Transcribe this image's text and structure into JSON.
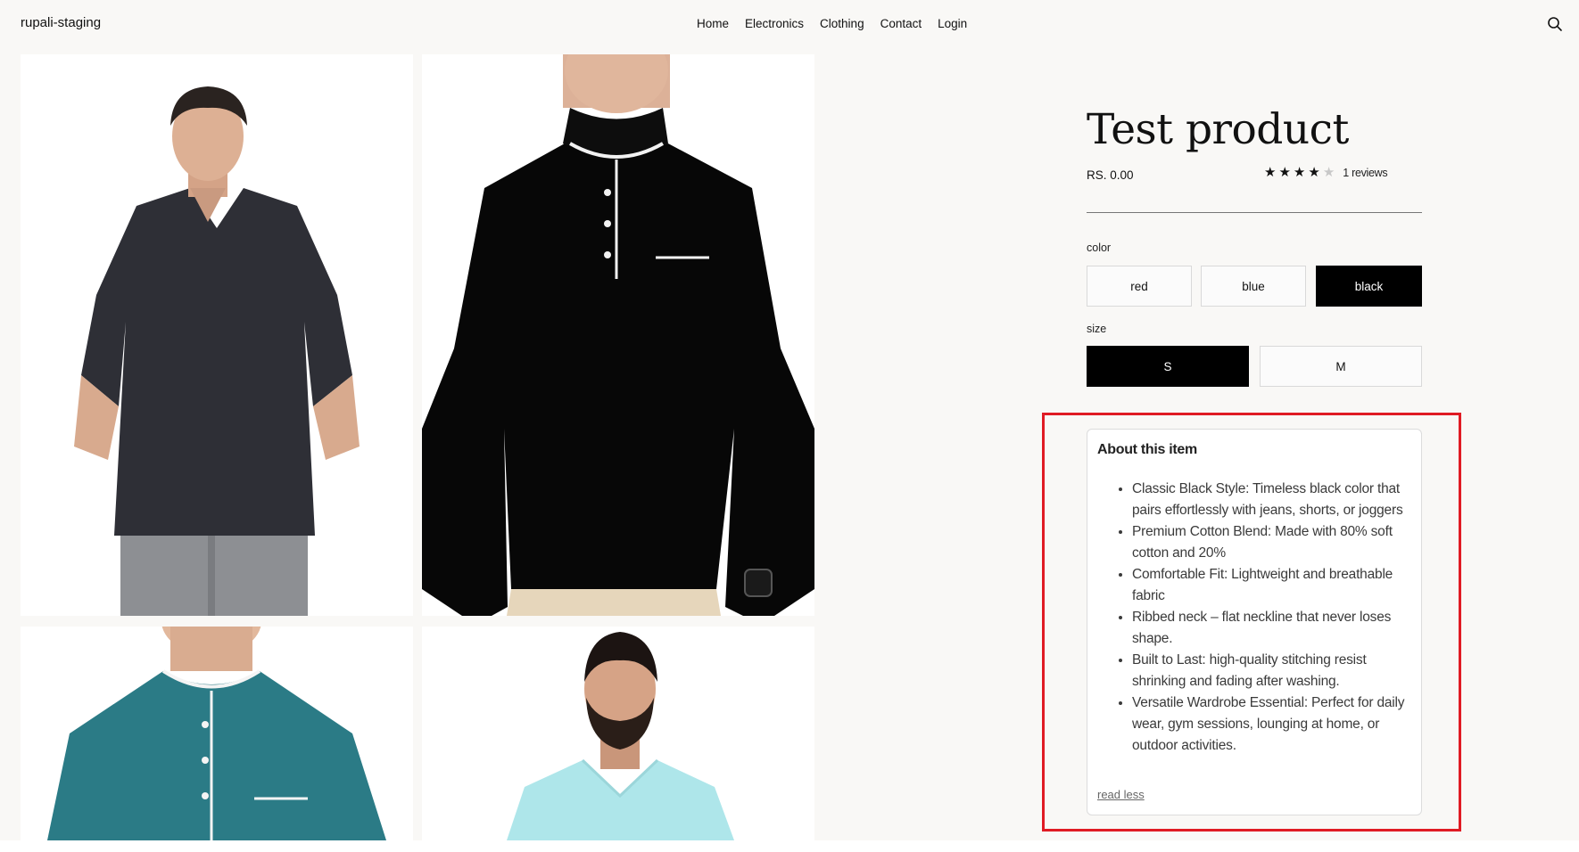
{
  "header": {
    "brand": "rupali-staging",
    "nav": [
      "Home",
      "Electronics",
      "Clothing",
      "Contact",
      "Login"
    ],
    "search_icon": "search-icon"
  },
  "product": {
    "title": "Test product",
    "price": "RS. 0.00",
    "rating": {
      "value": 4,
      "max": 5,
      "reviews_text": "1 reviews"
    },
    "color_label": "color",
    "colors": [
      "red",
      "blue",
      "black"
    ],
    "selected_color": "black",
    "size_label": "size",
    "sizes": [
      "S",
      "M"
    ],
    "selected_size": "S"
  },
  "about": {
    "heading": "About this item",
    "items": [
      "Classic Black Style: Timeless black color that pairs effortlessly with jeans, shorts, or joggers",
      "Premium Cotton Blend: Made with 80% soft cotton and 20%",
      "Comfortable Fit: Lightweight and breathable fabric",
      "Ribbed neck – flat neckline that never loses shape.",
      "Built to Last: high-quality stitching resist shrinking and fading after washing.",
      "Versatile Wardrobe Essential: Perfect for daily wear, gym sessions, lounging at home, or outdoor activities."
    ],
    "read_less": "read less"
  },
  "colors": {
    "accent_selected": "#000000",
    "highlight": "#e01b24",
    "shirt_dark_grey": "#2e2f36",
    "shirt_black": "#070707",
    "shirt_teal": "#2b7b86",
    "shirt_light_cyan": "#aee6ea"
  }
}
